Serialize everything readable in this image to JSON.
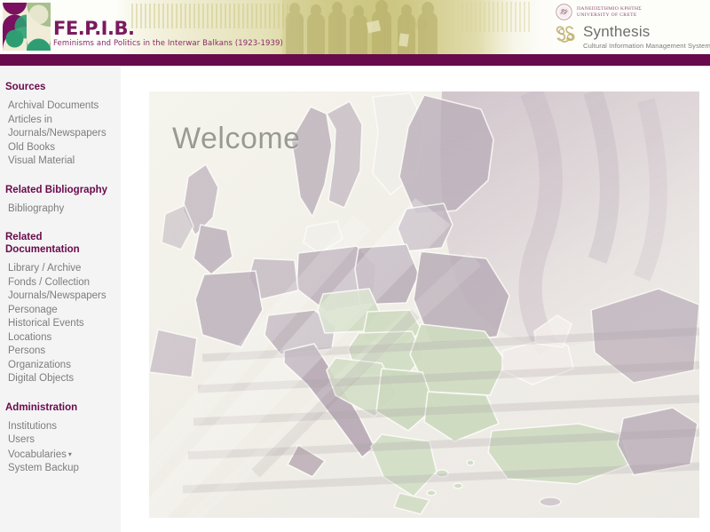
{
  "header": {
    "brand_title": "FE.P.I.B.",
    "brand_subtitle": "Feminisms and Politics in the Interwar Balkans (1923-1939)",
    "university_greek": "ΠΑΝΕΠΙΣΤΗΜΙΟ ΚΡΗΤΗΣ",
    "university_english": "UNIVERSITY OF CRETE",
    "synthesis_name": "Synthesis",
    "synthesis_tagline": "Cultural Information Management System"
  },
  "colors": {
    "accent_purple": "#690a4c",
    "sidebar_bg": "#f4f4f4",
    "link_gray": "#7d7d7d",
    "banner_olive": "#cdc678"
  },
  "sidebar": {
    "sections": [
      {
        "title": "Sources",
        "items": [
          {
            "label": "Archival Documents",
            "name": "archival-documents"
          },
          {
            "label": "Articles in Journals/Newspapers",
            "name": "articles-in-journals-newspapers"
          },
          {
            "label": "Old Books",
            "name": "old-books"
          },
          {
            "label": "Visual Material",
            "name": "visual-material"
          }
        ]
      },
      {
        "title": "Related Bibliography",
        "items": [
          {
            "label": "Bibliography",
            "name": "bibliography"
          }
        ]
      },
      {
        "title": "Related Documentation",
        "items": [
          {
            "label": "Library / Archive",
            "name": "library-archive"
          },
          {
            "label": "Fonds / Collection",
            "name": "fonds-collection"
          },
          {
            "label": "Journals/Newspapers",
            "name": "journals-newspapers"
          },
          {
            "label": "Personage",
            "name": "personage"
          },
          {
            "label": "Historical Events",
            "name": "historical-events"
          },
          {
            "label": "Locations",
            "name": "locations"
          },
          {
            "label": "Persons",
            "name": "persons"
          },
          {
            "label": "Organizations",
            "name": "organizations"
          },
          {
            "label": "Digital Objects",
            "name": "digital-objects"
          }
        ]
      },
      {
        "title": "Administration",
        "items": [
          {
            "label": "Institutions",
            "name": "institutions"
          },
          {
            "label": "Users",
            "name": "users"
          },
          {
            "label": "Vocabularies",
            "name": "vocabularies",
            "caret": "▾"
          },
          {
            "label": "System Backup",
            "name": "system-backup"
          }
        ]
      }
    ]
  },
  "main": {
    "hero_title": "Welcome",
    "hero_image_alt": "Faded map of Europe with the Balkan region highlighted in green"
  }
}
